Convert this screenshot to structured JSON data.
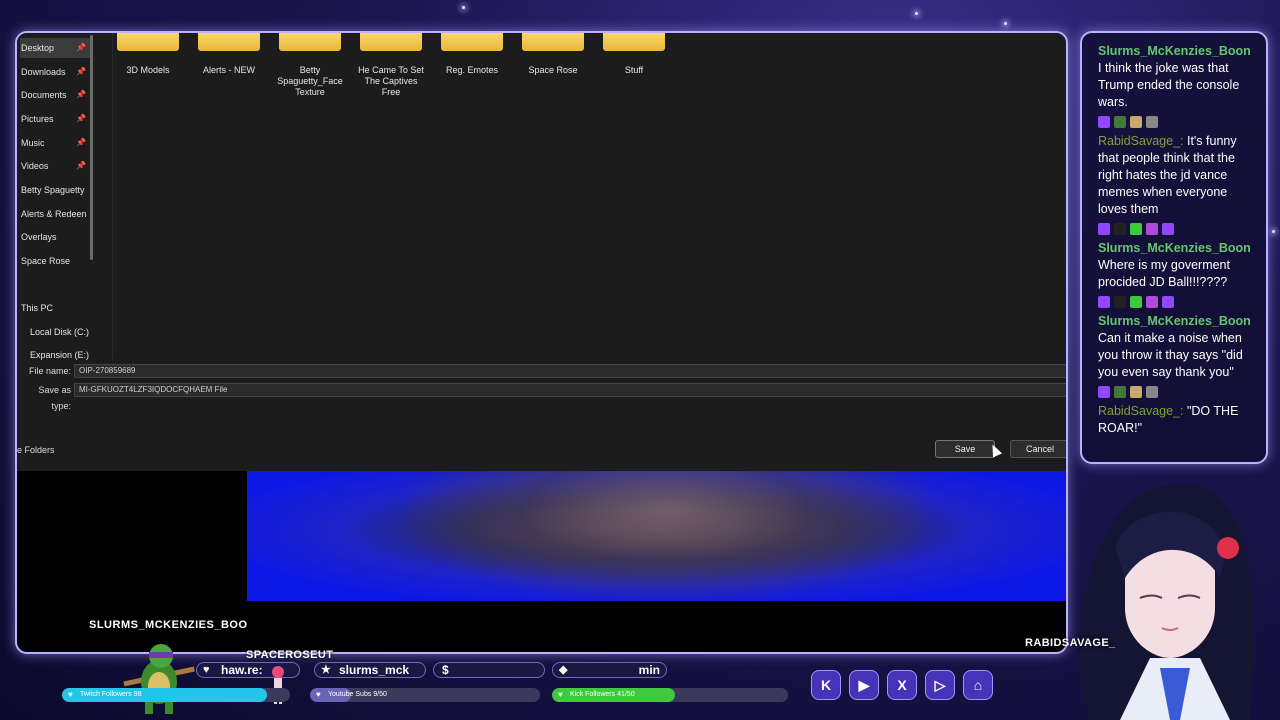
{
  "dialog": {
    "nav_items": [
      {
        "label": "Desktop",
        "pinned": true,
        "active": true
      },
      {
        "label": "Downloads",
        "pinned": true
      },
      {
        "label": "Documents",
        "pinned": true
      },
      {
        "label": "Pictures",
        "pinned": true
      },
      {
        "label": "Music",
        "pinned": true
      },
      {
        "label": "Videos",
        "pinned": true
      },
      {
        "label": "Betty Spaguetty",
        "pinned": false
      },
      {
        "label": "Alerts & Redeen",
        "pinned": false
      },
      {
        "label": "Overlays",
        "pinned": false
      },
      {
        "label": "Space Rose",
        "pinned": false
      },
      {
        "label": "This PC",
        "pinned": false
      },
      {
        "label": "Local Disk (C:)",
        "pinned": false
      },
      {
        "label": "Expansion (E:)",
        "pinned": false
      }
    ],
    "folders": [
      "3D Models",
      "Alerts - NEW",
      "Betty Spaguetty_Face Texture",
      "He Came To Set The Captives Free",
      "Reg. Emotes",
      "Space Rose",
      "Stuff"
    ],
    "file_name_label": "File name:",
    "file_name_value": "OIP-270859689",
    "save_type_label": "Save as type:",
    "save_type_value": "MI-GFKUOZT4LZF3IQDOCFQHAEM File",
    "hide_folders": "e Folders",
    "save_button": "Save",
    "cancel_button": "Cancel"
  },
  "last_event": "SLURMS_MCKENZIES_BOO",
  "chat": {
    "messages": [
      {
        "user": "Slurms_McKenzies_Boon",
        "user_color": "green",
        "text": "I think the joke was that Trump ended the console wars."
      },
      {
        "user": "RabidSavage_:",
        "user_color": "olive",
        "text": "It's funny that people think that the right hates the jd vance memes when everyone loves them"
      },
      {
        "user": "Slurms_McKenzies_Boon",
        "user_color": "green",
        "text": "Where is my goverment procided JD Ball!!!????"
      },
      {
        "user": "Slurms_McKenzies_Boon",
        "user_color": "green",
        "text": "Can it make a noise when you throw it thay says \"did you even say thank you\""
      },
      {
        "user": "RabidSavage_:",
        "user_color": "olive",
        "text": "\"DO THE ROAR!\""
      }
    ]
  },
  "vtuber_name": "RABIDSAVAGE_",
  "bottom": {
    "spaceroseut": "SPACEROSEUT",
    "pill_heart": "haw.re:",
    "pill_star": "slurms_mck",
    "pill_dollar": "$",
    "pill_diamond": "min",
    "twitch_followers": "Twitch Followers 98",
    "twitch_followers_progress": 0.9,
    "youtube_subs": "Youtube Subs 9/50",
    "youtube_subs_progress": 0.18,
    "kick_followers": "Kick Followers 41/50",
    "kick_followers_progress": 0.52,
    "social_icons": [
      "kick-icon",
      "youtube-icon",
      "x-icon",
      "play-icon",
      "twitch-icon"
    ],
    "social_glyphs": [
      "K",
      "▶",
      "X",
      "▷",
      "⌂"
    ]
  },
  "colors": {
    "frame": "#b9b3ff",
    "chat_green": "#63c86b",
    "chat_olive": "#7ea339",
    "twitch_bar": "#23c6e8",
    "kick_bar": "#3ec93e"
  }
}
